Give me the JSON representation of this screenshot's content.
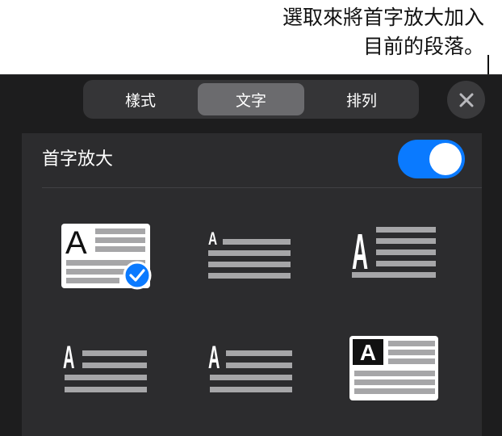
{
  "callout": {
    "line1": "選取來將首字放大加入",
    "line2": "目前的段落。"
  },
  "tabs": [
    {
      "label": "樣式",
      "active": false
    },
    {
      "label": "文字",
      "active": true
    },
    {
      "label": "排列",
      "active": false
    }
  ],
  "drop_cap": {
    "label": "首字放大",
    "enabled": true
  },
  "styles": [
    {
      "letter": "A",
      "selected": true
    },
    {
      "letter": "A",
      "selected": false
    },
    {
      "letter": "A",
      "selected": false
    },
    {
      "letter": "A",
      "selected": false
    },
    {
      "letter": "A",
      "selected": false
    },
    {
      "letter": "A",
      "selected": false
    }
  ],
  "colors": {
    "accent": "#0a7aff",
    "panel": "#1d1d1e",
    "sheet": "#2c2c2e"
  }
}
